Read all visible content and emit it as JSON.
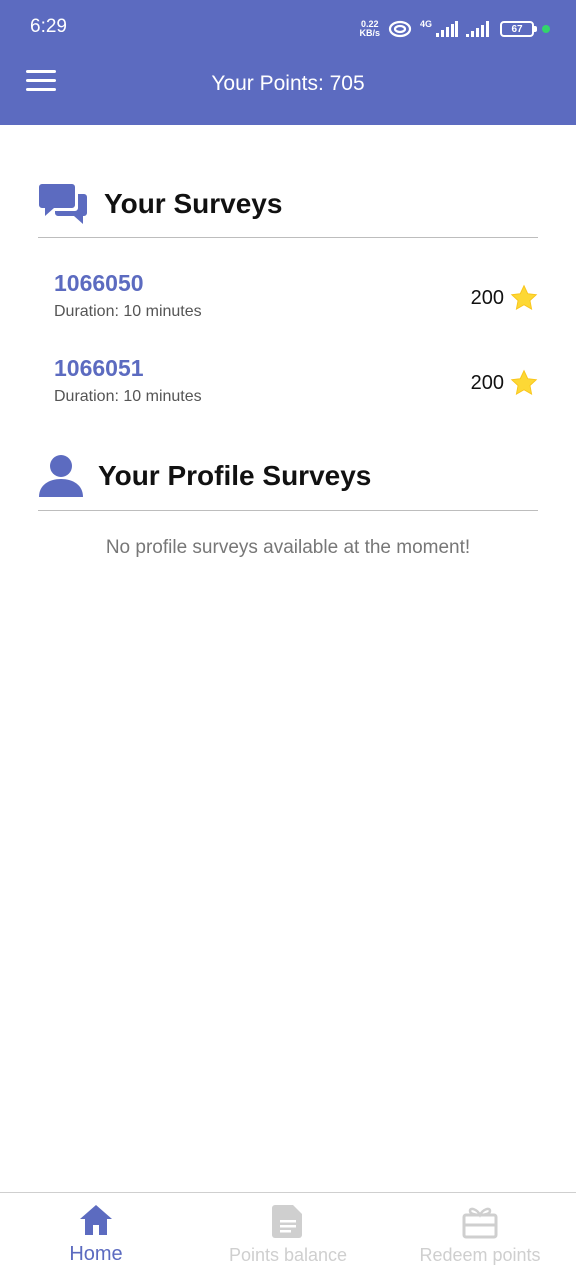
{
  "status_bar": {
    "time": "6:29",
    "net_speed_value": "0.22",
    "net_speed_unit": "KB/s",
    "network_type": "4G",
    "battery": "67"
  },
  "header": {
    "title": "Your Points: 705",
    "menu_icon": "hamburger-menu-icon",
    "background_color": "#5c6bc0"
  },
  "surveys_section": {
    "title": "Your Surveys",
    "icon": "chat-bubbles-icon",
    "items": [
      {
        "id": "1066050",
        "duration": "Duration: 10 minutes",
        "points": "200",
        "icon": "star-icon"
      },
      {
        "id": "1066051",
        "duration": "Duration: 10 minutes",
        "points": "200",
        "icon": "star-icon"
      }
    ]
  },
  "profile_section": {
    "title": "Your Profile Surveys",
    "icon": "person-icon",
    "empty_message": "No profile surveys available at the moment!"
  },
  "bottom_nav": {
    "items": [
      {
        "label": "Home",
        "icon": "home-icon",
        "active": true
      },
      {
        "label": "Points balance",
        "icon": "document-icon",
        "active": false
      },
      {
        "label": "Redeem points",
        "icon": "gift-icon",
        "active": false
      }
    ]
  },
  "colors": {
    "accent": "#5c6bc0",
    "star": "#fdd835",
    "inactive": "#cfcfcf"
  }
}
